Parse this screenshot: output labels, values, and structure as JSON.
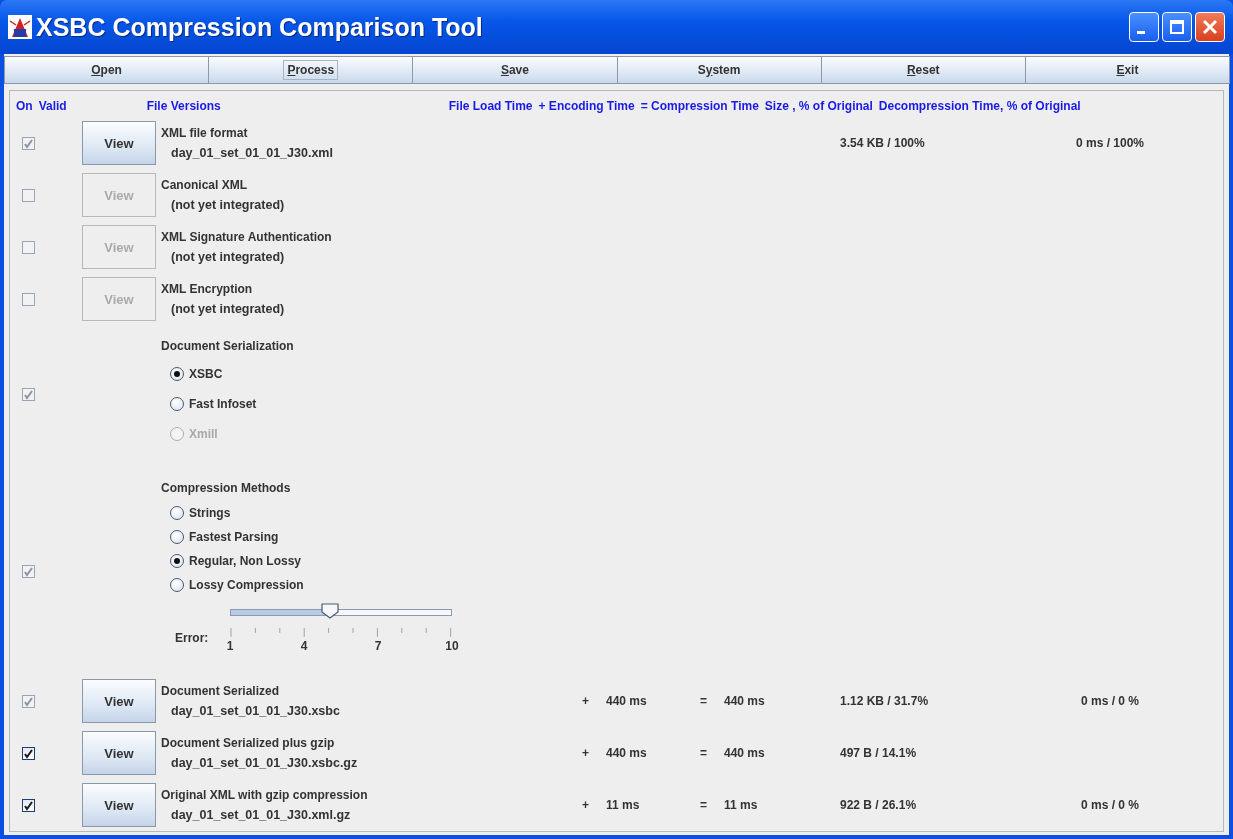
{
  "window": {
    "title": "XSBC Compression Comparison Tool"
  },
  "toolbar": [
    {
      "mnemonic": "O",
      "label_after": "pen",
      "focused": false
    },
    {
      "mnemonic": "P",
      "label_after": "rocess",
      "focused": true
    },
    {
      "mnemonic": "S",
      "label_after": "ave",
      "focused": false
    },
    {
      "label_before": "S",
      "mnemonic": "y",
      "label_after": "stem",
      "focused": false
    },
    {
      "mnemonic": "R",
      "label_after": "eset",
      "focused": false
    },
    {
      "mnemonic": "E",
      "label_after": "xit",
      "focused": false
    }
  ],
  "header": {
    "on": "On",
    "valid": "Valid",
    "versions": "File Versions",
    "load": "File Load Time",
    "encoding": "+ Encoding Time",
    "compression": "= Compression Time",
    "size": "Size , % of Original",
    "decompression": "Decompression Time, % of Original"
  },
  "rows": [
    {
      "kind": "file",
      "checked": true,
      "disabled": true,
      "view": {
        "label": "View",
        "disabled": false
      },
      "title": "XML file format",
      "file": "day_01_set_01_01_J30.xml",
      "size": "3.54 KB /  100%",
      "decompression": "0 ms /  100%"
    },
    {
      "kind": "file",
      "checked": false,
      "disabled": true,
      "view": {
        "label": "View",
        "disabled": true
      },
      "title": "Canonical XML",
      "file": "(not yet integrated)"
    },
    {
      "kind": "file",
      "checked": false,
      "disabled": true,
      "view": {
        "label": "View",
        "disabled": true
      },
      "title": "XML Signature Authentication",
      "file": "(not yet integrated)"
    },
    {
      "kind": "file",
      "checked": false,
      "disabled": true,
      "view": {
        "label": "View",
        "disabled": true
      },
      "title": "XML Encryption",
      "file": "(not yet integrated)"
    },
    {
      "kind": "options",
      "checked": true,
      "disabled": true,
      "title": "Document Serialization",
      "options": [
        {
          "label": "XSBC",
          "selected": true,
          "disabled": false
        },
        {
          "label": "Fast Infoset",
          "selected": false,
          "disabled": false
        },
        {
          "label": "Xmill",
          "selected": false,
          "disabled": true
        }
      ]
    },
    {
      "kind": "options",
      "checked": true,
      "disabled": true,
      "title": "Compression Methods",
      "options": [
        {
          "label": "Strings",
          "selected": false,
          "disabled": false
        },
        {
          "label": "Fastest Parsing",
          "selected": false,
          "disabled": false
        },
        {
          "label": "Regular, Non Lossy",
          "selected": true,
          "disabled": false
        },
        {
          "label": "Lossy Compression",
          "selected": false,
          "disabled": false
        }
      ],
      "slider": {
        "label": "Error:",
        "level": 0.45,
        "tick_labels": [
          "1",
          "4",
          "7",
          "10"
        ]
      }
    },
    {
      "kind": "file",
      "checked": true,
      "disabled": true,
      "view": {
        "label": "View",
        "disabled": false
      },
      "title": "Document Serialized",
      "file": "day_01_set_01_01_J30.xsbc",
      "plus": "+",
      "encoding": "440 ms",
      "equals": "=",
      "compression": "440 ms",
      "size": "1.12 KB / 31.7%",
      "decompression": "0 ms /  0 %"
    },
    {
      "kind": "file",
      "checked": true,
      "disabled": false,
      "view": {
        "label": "View",
        "disabled": false
      },
      "title": "Document Serialized plus gzip",
      "file": "day_01_set_01_01_J30.xsbc.gz",
      "plus": "+",
      "encoding": "440 ms",
      "equals": "=",
      "compression": "440 ms",
      "size": "497 B / 14.1%"
    },
    {
      "kind": "file",
      "checked": true,
      "disabled": false,
      "view": {
        "label": "View",
        "disabled": false
      },
      "title": "Original XML with gzip compression",
      "file": "day_01_set_01_01_J30.xml.gz",
      "plus": "+",
      "encoding": "11 ms",
      "equals": "=",
      "compression": "11 ms",
      "size": "922 B / 26.1%",
      "decompression": "0 ms /  0 %"
    }
  ]
}
